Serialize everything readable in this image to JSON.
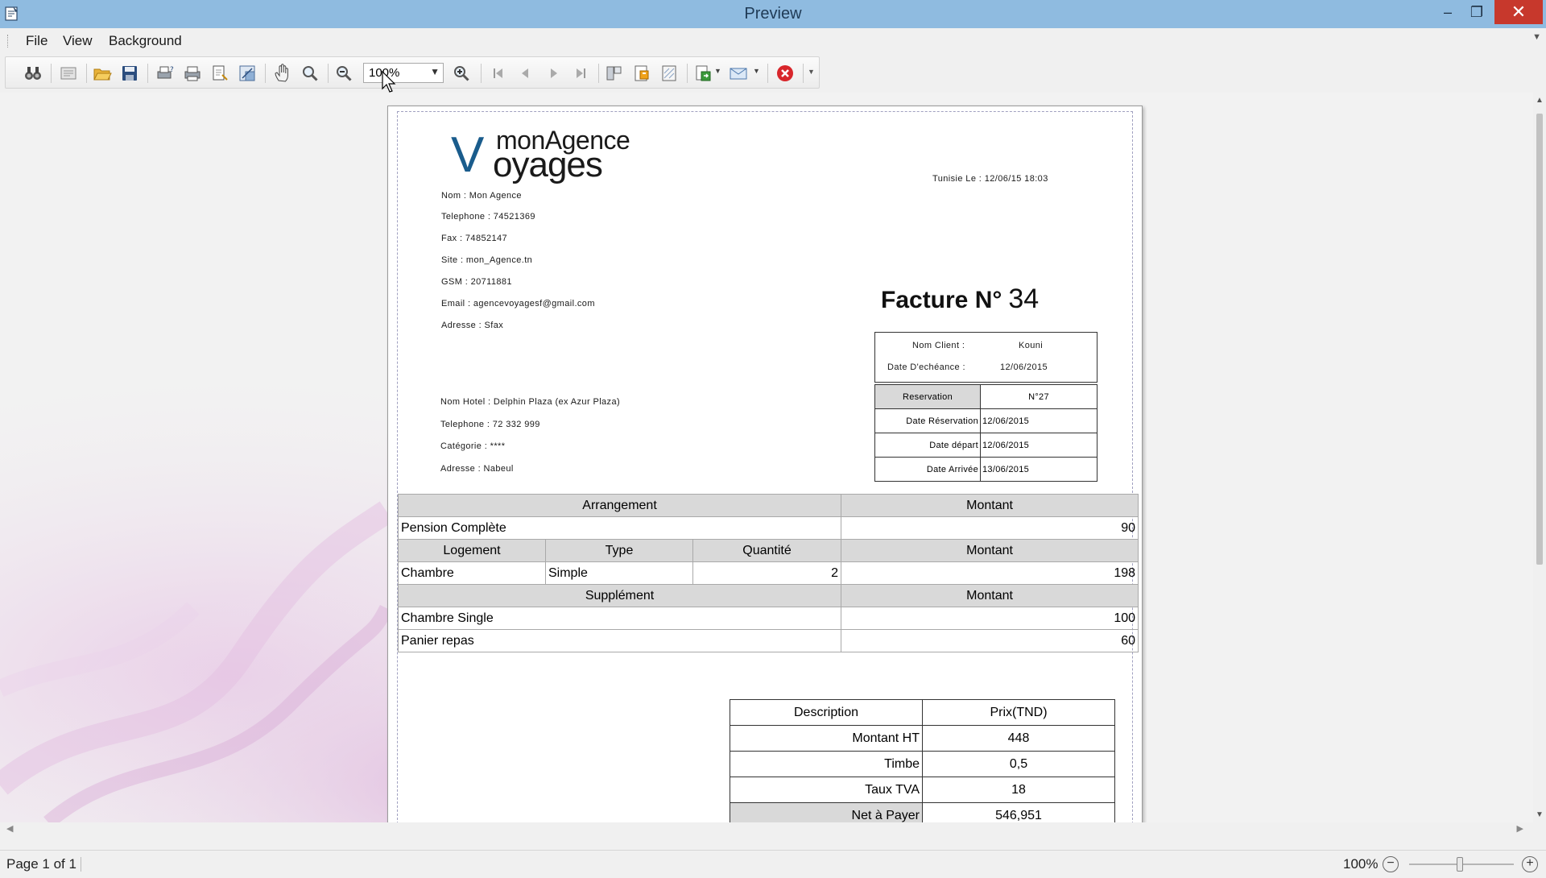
{
  "window": {
    "title": "Preview"
  },
  "menu": {
    "file": "File",
    "view": "View",
    "background": "Background"
  },
  "toolbar": {
    "icons": [
      "binoculars-icon",
      "parameters-icon",
      "open-icon",
      "save-icon",
      "print-dialog-icon",
      "print-icon",
      "page-setup-icon",
      "scale-icon",
      "hand-icon",
      "magnifier-icon",
      "zoom-out-icon",
      "zoom-in-icon",
      "first-page-icon",
      "prev-page-icon",
      "next-page-icon",
      "last-page-icon",
      "editor-icon",
      "header-footer-icon",
      "watermark-icon",
      "export-icon",
      "send-email-icon",
      "close-preview-icon"
    ],
    "zoom_value": "100%"
  },
  "invoice": {
    "agency": {
      "name": "Nom : Mon Agence",
      "telephone": "Telephone : 74521369",
      "fax": "Fax : 74852147",
      "site": "Site : mon_Agence.tn",
      "gsm": "GSM : 20711881",
      "email": "Email : agencevoyagesf@gmail.com",
      "adresse": "Adresse : Sfax"
    },
    "logo": {
      "v": "V",
      "mon": "monAgence",
      "oyages": "oyages"
    },
    "date_line": "Tunisie Le : 12/06/15 18:03",
    "title_label": "Facture N°",
    "title_number": "34",
    "client": {
      "nom_label": "Nom Client :",
      "nom_value": "Kouni",
      "echeance_label": "Date D'echéance :",
      "echeance_value": "12/06/2015"
    },
    "reservation": [
      {
        "label": "Reservation",
        "value": "N°27"
      },
      {
        "label": "Date Réservation",
        "value": "12/06/2015"
      },
      {
        "label": "Date départ",
        "value": "12/06/2015"
      },
      {
        "label": "Date Arrivée",
        "value": "13/06/2015"
      }
    ],
    "hotel": {
      "nom": "Nom Hotel : Delphin Plaza (ex Azur Plaza)",
      "telephone": "Telephone : 72 332 999",
      "categorie": "Catégorie : ****",
      "adresse": "Adresse : Nabeul"
    },
    "table": {
      "arrangement_header": "Arrangement",
      "montant_header": "Montant",
      "arrangement_row": {
        "label": "Pension Complète",
        "montant": "90"
      },
      "logement_headers": [
        "Logement",
        "Type",
        "Quantité",
        "Montant"
      ],
      "logement_row": {
        "logement": "Chambre",
        "type": "Simple",
        "quantite": "2",
        "montant": "198"
      },
      "supplement_header": "Supplément",
      "supplements": [
        {
          "label": "Chambre Single",
          "montant": "100"
        },
        {
          "label": "Panier repas",
          "montant": "60"
        }
      ]
    },
    "totals": {
      "headers": [
        "Description",
        "Prix(TND)"
      ],
      "rows": [
        {
          "label": "Montant HT",
          "value": "448"
        },
        {
          "label": "Timbe",
          "value": "0,5"
        },
        {
          "label": "Taux TVA",
          "value": "18"
        },
        {
          "label": "Net à Payer",
          "value": "546,951"
        }
      ]
    }
  },
  "status": {
    "page_info": "Page 1 of 1",
    "zoom": "100%",
    "zoom_slider_percent": 46
  },
  "colors": {
    "titlebar": "#8fbbe0",
    "close": "#c7382c",
    "logo_blue": "#1a5c8c",
    "header_gray": "#d9d9d9"
  }
}
